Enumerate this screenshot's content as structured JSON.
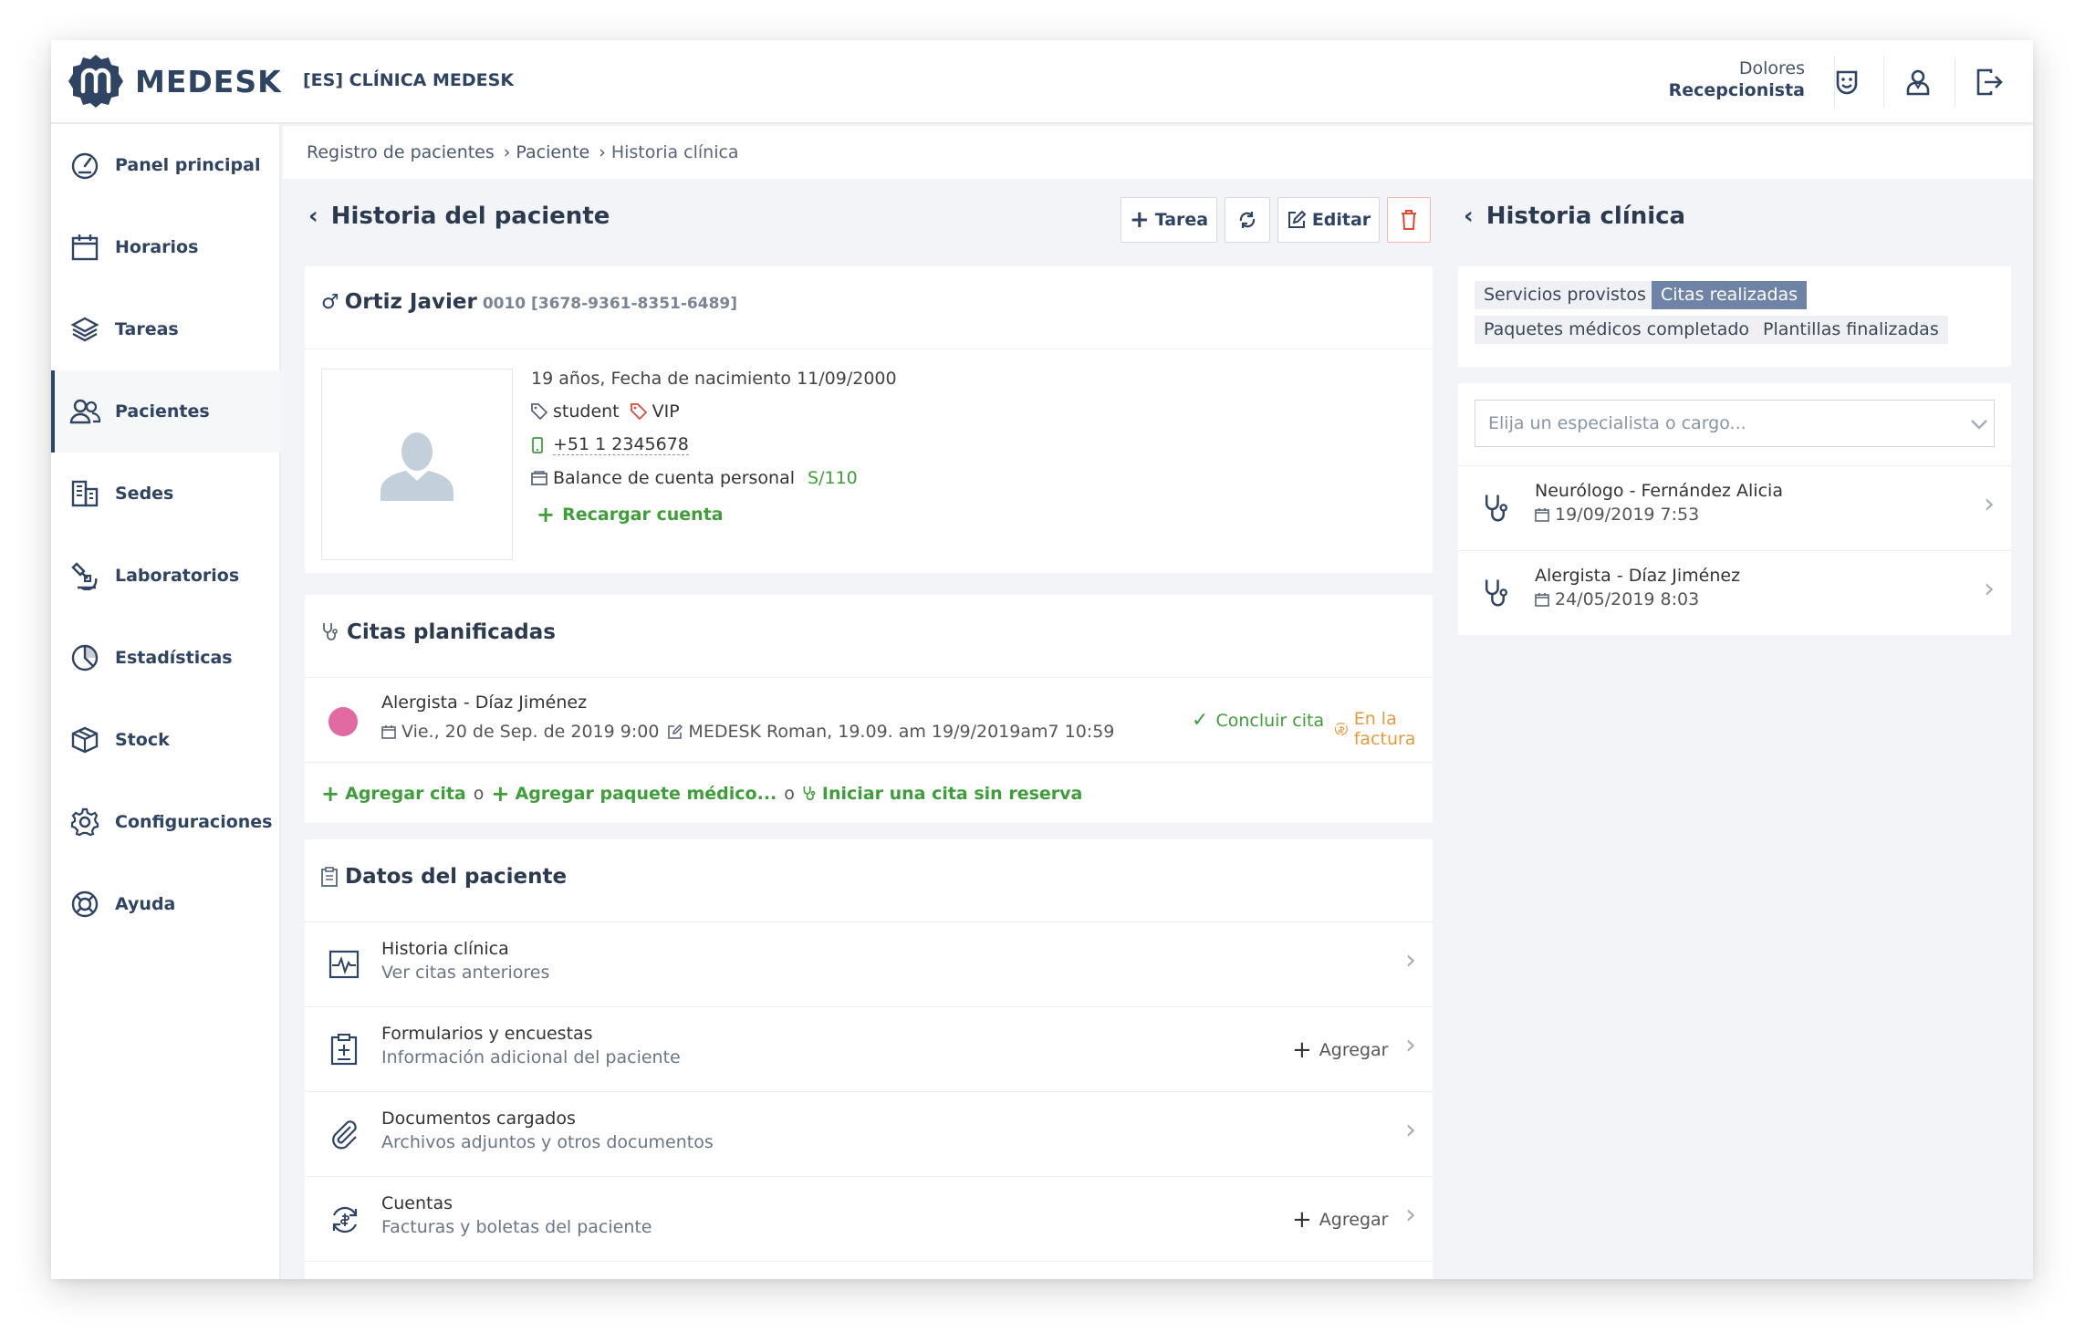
{
  "app": {
    "name": "MEDESK",
    "clinic": "[ES] CLÍNICA MEDESK"
  },
  "user": {
    "name": "Dolores",
    "role": "Recepcionista"
  },
  "topbar_icons": [
    "face-icon",
    "doctor-icon",
    "logout-icon"
  ],
  "sidebar": {
    "items": [
      {
        "label": "Panel principal",
        "icon": "dashboard-icon"
      },
      {
        "label": "Horarios",
        "icon": "calendar-icon"
      },
      {
        "label": "Tareas",
        "icon": "layers-icon"
      },
      {
        "label": "Pacientes",
        "icon": "users-icon",
        "active": true
      },
      {
        "label": "Sedes",
        "icon": "building-icon"
      },
      {
        "label": "Laboratorios",
        "icon": "lab-icon"
      },
      {
        "label": "Estadísticas",
        "icon": "pie-chart-icon"
      },
      {
        "label": "Stock",
        "icon": "box-icon"
      },
      {
        "label": "Configuraciones",
        "icon": "gear-icon"
      },
      {
        "label": "Ayuda",
        "icon": "lifebuoy-icon"
      }
    ]
  },
  "breadcrumb": [
    "Registro de pacientes",
    "Paciente",
    "Historia clínica"
  ],
  "main": {
    "title": "Historia del paciente",
    "buttons": {
      "task": "Tarea",
      "edit": "Editar"
    },
    "patient": {
      "name": "Ortiz Javier",
      "id": "0010 [3678-9361-8351-6489]",
      "age_line": "19 años, Fecha de nacimiento 11/09/2000",
      "tags": [
        "student",
        "VIP"
      ],
      "phone": "+51 1 2345678",
      "balance_label": "Balance de cuenta personal",
      "balance_value": "S/110",
      "recharge": "Recargar cuenta"
    },
    "planned": {
      "title": "Citas planificadas",
      "appointment": {
        "title": "Alergista - Díaz Jiménez",
        "date": "Vie., 20 de Sep. de 2019 9:00",
        "note": "MEDESK Roman, 19.09. am 19/9/2019am7 10:59",
        "conclude": "Concluir cita",
        "invoice": "En la factura"
      },
      "actions": {
        "add_appt": "Agregar cita",
        "or1": "o",
        "add_package": "Agregar paquete médico...",
        "or2": "o",
        "start_walkin": "Iniciar una cita sin reserva"
      }
    },
    "data": {
      "title": "Datos del paciente",
      "rows": [
        {
          "title": "Historia clínica",
          "sub": "Ver citas anteriores",
          "action": ""
        },
        {
          "title": "Formularios y encuestas",
          "sub": "Información adicional del paciente",
          "action": "Agregar"
        },
        {
          "title": "Documentos cargados",
          "sub": "Archivos adjuntos y otros documentos",
          "action": ""
        },
        {
          "title": "Cuentas",
          "sub": "Facturas y boletas del paciente",
          "action": "Agregar"
        }
      ]
    }
  },
  "right": {
    "title": "Historia clínica",
    "tags": [
      "Servicios provistos",
      "Citas realizadas",
      "Paquetes médicos completado",
      "Plantillas finalizadas"
    ],
    "active_tag": "Citas realizadas",
    "select_placeholder": "Elija un especialista o cargo...",
    "visits": [
      {
        "title": "Neurólogo - Fernández Alicia",
        "date": "19/09/2019 7:53"
      },
      {
        "title": "Alergista - Díaz Jiménez",
        "date": "24/05/2019 8:03"
      }
    ]
  },
  "colors": {
    "brand": "#2f4363",
    "green": "#3f9e3a",
    "orange": "#e49a3e",
    "pink": "#e26aa3",
    "delete": "#e0483a",
    "active_tag": "#6f83a6"
  }
}
